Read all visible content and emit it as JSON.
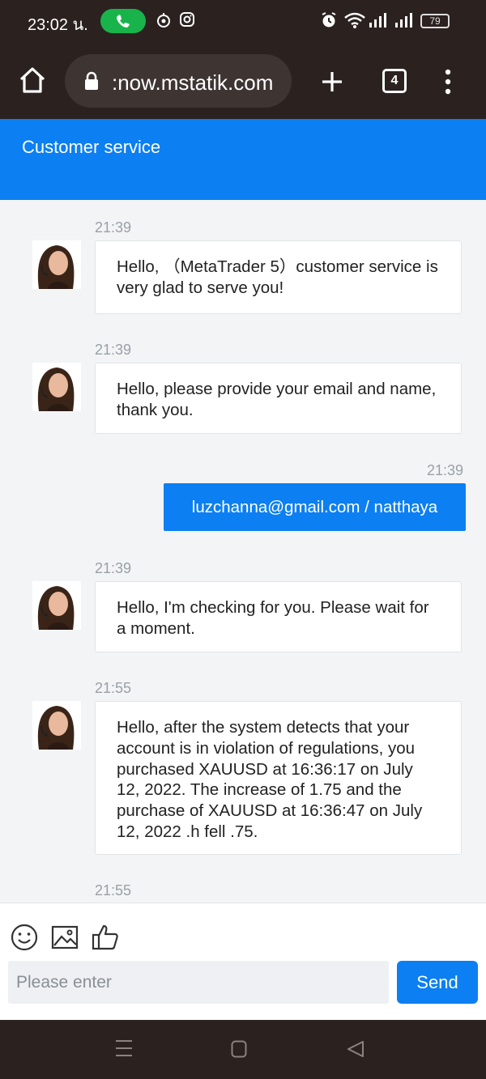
{
  "status_bar": {
    "time": "23:02 น.",
    "battery": "79"
  },
  "browser": {
    "url": ":now.mstatik.com",
    "tab_count": "4"
  },
  "header": {
    "title": "Customer service"
  },
  "messages": [
    {
      "time": "21:39",
      "text": "Hello, （MetaTrader 5）customer service is very glad to serve you!",
      "from": "agent"
    },
    {
      "time": "21:39",
      "text": "Hello, please provide your email and name, thank you.",
      "from": "agent"
    },
    {
      "time": "21:39",
      "text": "luzchanna@gmail.com / natthaya",
      "from": "user"
    },
    {
      "time": "21:39",
      "text": "Hello, I'm checking for you. Please wait for a moment.",
      "from": "agent"
    },
    {
      "time": "21:55",
      "text": "Hello, after the system detects that your account is in violation of regulations, you purchased XAUUSD at 16:36:17 on July 12, 2022. The increase of 1.75 and the purchase of XAUUSD at 16:36:47 on July 12, 2022 .h fell .75.",
      "from": "agent"
    },
    {
      "time": "21:55",
      "text": "",
      "from": "agent"
    }
  ],
  "composer": {
    "placeholder": "Please enter",
    "send_label": "Send"
  },
  "icons": {
    "emoji": "smiley-icon",
    "image": "image-icon",
    "like": "thumbs-up-icon"
  },
  "colors": {
    "accent": "#0c7ff2",
    "system_bar": "#2b2220",
    "chat_bg": "#f3f4f6",
    "call_green": "#19b34c"
  }
}
